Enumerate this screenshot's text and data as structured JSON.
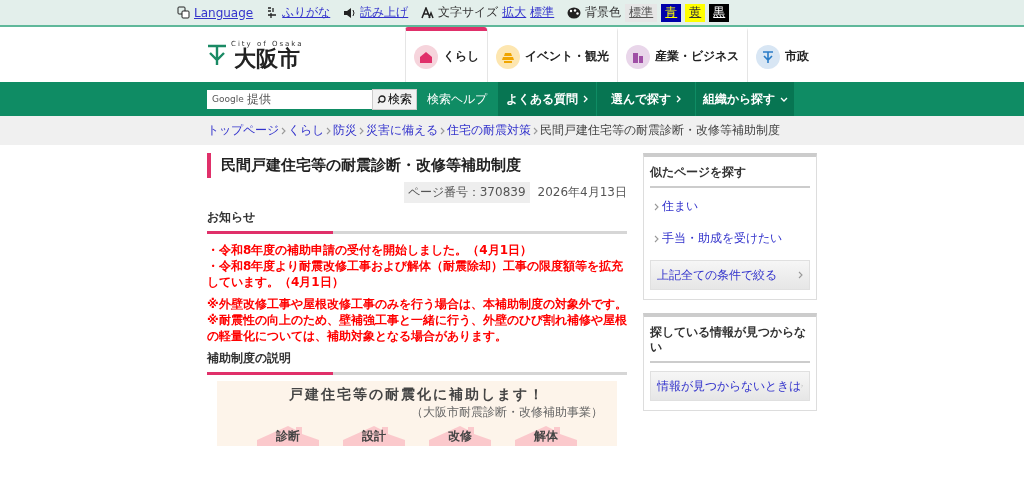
{
  "utility_bar": {
    "language": "Language",
    "furigana": "ふりがな",
    "read_aloud": "読み上げ",
    "font_size_label": "文字サイズ",
    "font_size_links": [
      "拡大",
      "標準"
    ],
    "background_label": "背景色",
    "background_options": [
      {
        "label": "標準",
        "kind": "default"
      },
      {
        "label": "青",
        "kind": "blue"
      },
      {
        "label": "黄",
        "kind": "yellow"
      },
      {
        "label": "黒",
        "kind": "black"
      }
    ]
  },
  "header": {
    "logo_sub": "City of Osaka",
    "logo_name": "大阪市",
    "categories": [
      {
        "label": "くらし",
        "kind": "house",
        "selected": true
      },
      {
        "label": "イベント・観光",
        "kind": "castle",
        "selected": false
      },
      {
        "label": "産業・ビジネス",
        "kind": "building",
        "selected": false
      },
      {
        "label": "市政",
        "kind": "emblem",
        "selected": false
      }
    ]
  },
  "nav": {
    "search_brand": "Google",
    "search_brand_sub": "提供",
    "search_button": "検索",
    "search_help": "検索ヘルプ",
    "items": [
      {
        "label": "よくある質問",
        "kind": "arrow"
      },
      {
        "label": "選んで探す",
        "kind": "arrow"
      },
      {
        "label": "組織から探す",
        "kind": "dropdown"
      }
    ]
  },
  "breadcrumb": {
    "links": [
      "トップページ",
      "くらし",
      "防災",
      "災害に備える",
      "住宅の耐震対策"
    ],
    "current": "民間戸建住宅等の耐震診断・改修等補助制度"
  },
  "page": {
    "title": "民間戸建住宅等の耐震診断・改修等補助制度",
    "page_number": "ページ番号：370839",
    "date": "2026年4月13日",
    "notice_heading": "お知らせ",
    "notices": [
      "・令和8年度の補助申請の受付を開始しました。（4月1日）",
      "・令和8年度より耐震改修工事および解体（耐震除却）工事の限度額等を拡充しています。（4月1日）"
    ],
    "notes": [
      "※外壁改修工事や屋根改修工事のみを行う場合は、本補助制度の対象外です。",
      "※耐震性の向上のため、壁補強工事と一緒に行う、外壁のひび割れ補修や屋根の軽量化については、補助対象となる場合があります。"
    ],
    "explanation_heading": "補助制度の説明",
    "banner": {
      "title": "戸建住宅等の耐震化に補助します！",
      "subtitle": "（大阪市耐震診断・改修補助事業）",
      "houses": [
        "診断",
        "設計",
        "改修",
        "解体"
      ]
    }
  },
  "sidebar": {
    "similar_heading": "似たページを探す",
    "similar_links": [
      "住まい",
      "手当・助成を受けたい"
    ],
    "filter_button": "上記全ての条件で絞る",
    "not_found_heading": "探している情報が見つからない",
    "not_found_button": "情報が見つからないときは"
  }
}
